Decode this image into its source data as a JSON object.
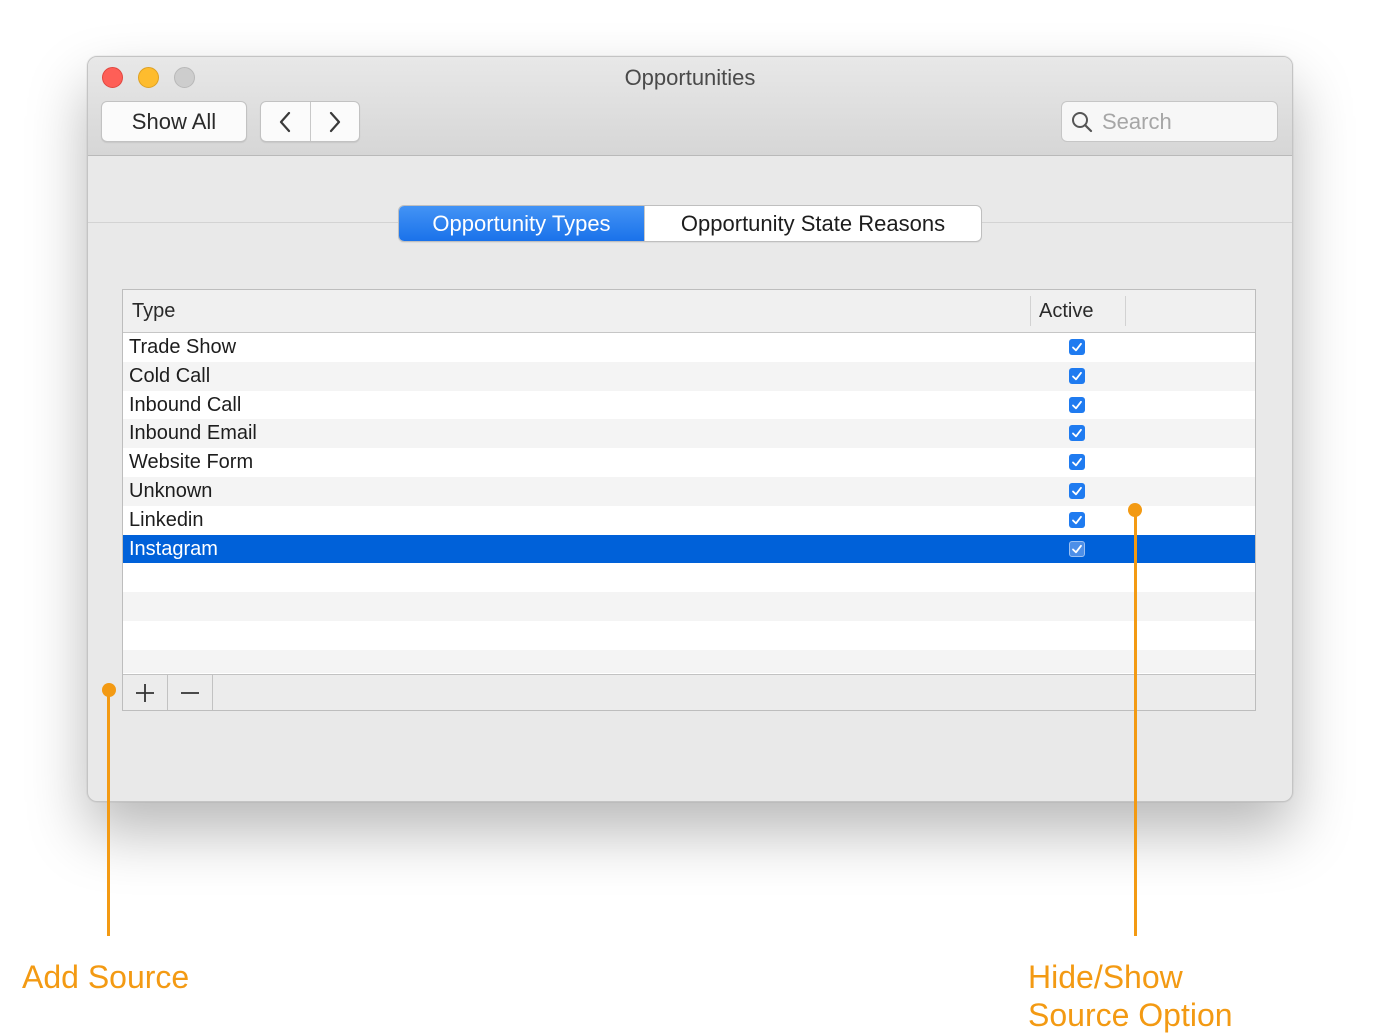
{
  "window": {
    "title": "Opportunities"
  },
  "toolbar": {
    "show_all_label": "Show All",
    "search_placeholder": "Search"
  },
  "tabs": [
    {
      "label": "Opportunity Types",
      "active": true
    },
    {
      "label": "Opportunity State Reasons",
      "active": false
    }
  ],
  "table": {
    "columns": [
      "Type",
      "Active"
    ],
    "rows": [
      {
        "type": "Trade Show",
        "active": true
      },
      {
        "type": "Cold Call",
        "active": true
      },
      {
        "type": "Inbound Call",
        "active": true
      },
      {
        "type": "Inbound Email",
        "active": true
      },
      {
        "type": "Website Form",
        "active": true
      },
      {
        "type": "Unknown",
        "active": true
      },
      {
        "type": "Linkedin",
        "active": true
      },
      {
        "type": "Instagram",
        "active": true,
        "selected": true
      }
    ],
    "footer": {
      "add_symbol": "+",
      "remove_symbol": "—"
    }
  },
  "annotations": {
    "add_source": "Add Source",
    "hide_show_line1": "Hide/Show",
    "hide_show_line2": "Source Option"
  },
  "colors": {
    "accent": "#1a72ea",
    "selection": "#0061d9",
    "annotation": "#f39a13"
  }
}
